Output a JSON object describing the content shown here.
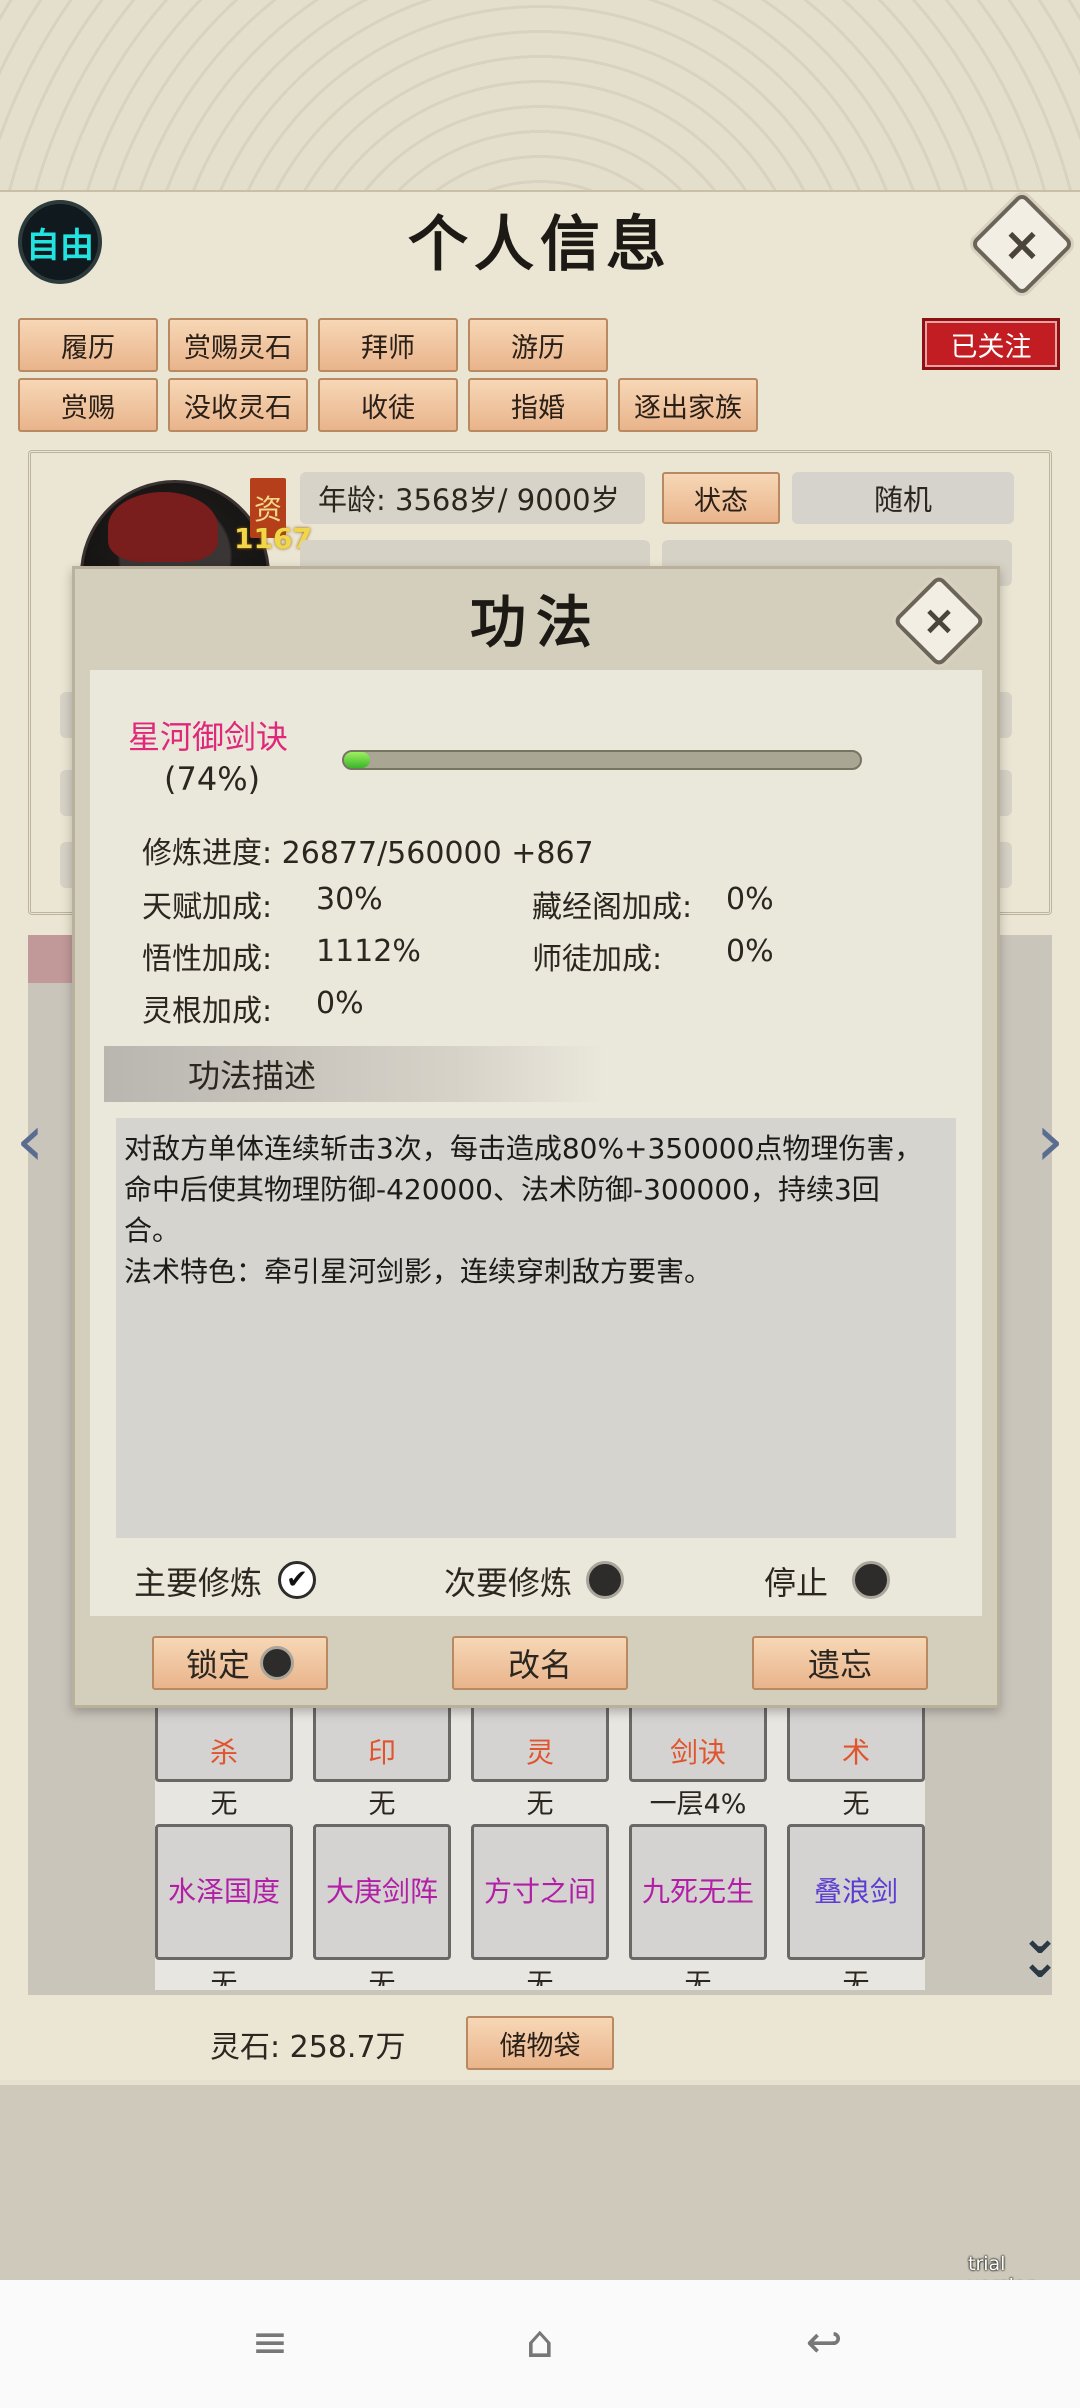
{
  "header": {
    "title": "个人信息",
    "mode_badge": "自由",
    "close_icon": "×"
  },
  "action_buttons_row1": [
    "履历",
    "赏赐灵石",
    "拜师",
    "游历"
  ],
  "action_buttons_row2": [
    "赏赐",
    "没收灵石",
    "收徒",
    "指婚",
    "逐出家族"
  ],
  "follow_button": "已关注",
  "profile": {
    "aptitude_tag": "资",
    "aptitude_value": "1167",
    "age": "年龄: 3568岁/ 9000岁",
    "status_button": "状态",
    "random_button": "随机"
  },
  "modal": {
    "title": "功法",
    "close_icon": "×",
    "technique_name": "星河御剑诀",
    "technique_percent_text": "(74%)",
    "progress_fraction": 0.05,
    "cultivation_progress": "修炼进度: 26877/560000  +867",
    "stats": {
      "talent_label": "天赋加成:",
      "talent_value": "30%",
      "library_label": "藏经阁加成:",
      "library_value": "0%",
      "comprehension_label": "悟性加成:",
      "comprehension_value": "1112%",
      "mentor_label": "师徒加成:",
      "mentor_value": "0%",
      "root_label": "灵根加成:",
      "root_value": "0%"
    },
    "desc_header": "功法描述",
    "description_lines": [
      "对敌方单体连续斩击3次，每击造成80%+350000点物理伤害，",
      "命中后使其物理防御-420000、法术防御-300000，持续3回",
      "合。",
      "法术特色：牵引星河剑影，连续穿刺敌方要害。"
    ],
    "radios": {
      "primary": "主要修炼",
      "secondary": "次要修炼",
      "stop": "停止",
      "checked_icon": "✔"
    },
    "buttons": {
      "lock": "锁定",
      "rename": "改名",
      "forget": "遗忘"
    }
  },
  "skills_top_row": [
    {
      "name": "杀",
      "level": "无"
    },
    {
      "name": "印",
      "level": "无"
    },
    {
      "name": "灵",
      "level": "无"
    },
    {
      "name": "剑诀",
      "level": "一层4%"
    },
    {
      "name": "术",
      "level": "无"
    }
  ],
  "skills_bottom_row": [
    {
      "name": "水泽国度",
      "level": "无"
    },
    {
      "name": "大庚剑阵",
      "level": "无"
    },
    {
      "name": "方寸之间",
      "level": "无"
    },
    {
      "name": "九死无生",
      "level": "无"
    },
    {
      "name": "叠浪剑",
      "level": "无"
    }
  ],
  "colors": {
    "skill_top_text": "#e0542e",
    "skill_bottom_text": "#b21ea6",
    "skill_bottom_last_text": "#5b3dd1",
    "technique_name": "#e0277a",
    "follow_red": "#c21d22"
  },
  "footer": {
    "spirit_stones": "灵石: 258.7万",
    "storage_button": "储物袋",
    "trial": "trial version",
    "expand_icon": "chevron-double-down"
  },
  "nav": {
    "menu_icon": "≡",
    "home_icon": "⌂",
    "back_icon": "↩"
  }
}
